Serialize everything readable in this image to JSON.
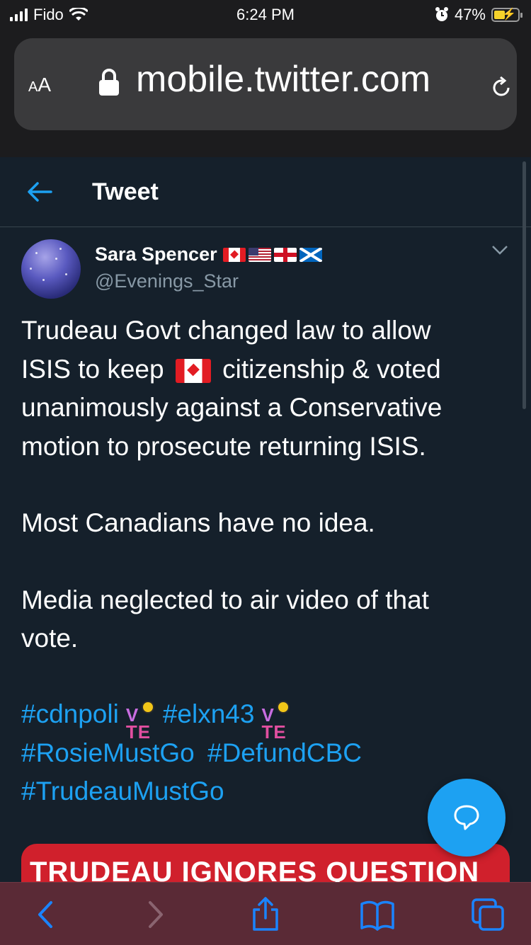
{
  "status_bar": {
    "carrier": "Fido",
    "time": "6:24 PM",
    "battery": "47%"
  },
  "browser": {
    "text_size_label": "AA",
    "url": "mobile.twitter.com"
  },
  "header": {
    "title": "Tweet"
  },
  "tweet": {
    "author_name": "Sara Spencer",
    "author_handle": "@Evenings_Star",
    "line1": "Trudeau Govt changed law to allow",
    "line2a": "ISIS to keep",
    "line2b": "citizenship & voted",
    "line3": "unanimously against a Conservative",
    "line4": "motion to prosecute returning ISIS.",
    "para2": "Most Canadians have no idea.",
    "para3": "Media neglected to air video of that vote.",
    "hashtags": [
      "#cdnpoli",
      "#elxn43",
      "#RosieMustGo",
      "#DefundCBC",
      "#TrudeauMustGo"
    ],
    "media_caption": "TRUDEAU IGNORES QUESTION"
  },
  "colors": {
    "background": "#15202b",
    "link": "#1da1f2",
    "safari_toolbar": "#5a2a36"
  }
}
